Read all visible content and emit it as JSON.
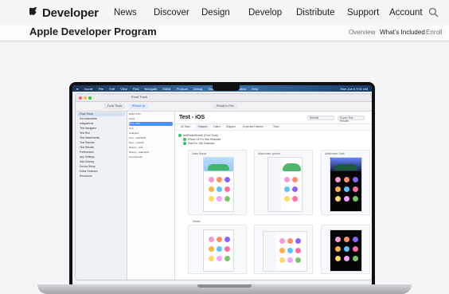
{
  "global_nav": {
    "brand": "Developer",
    "items": [
      "News",
      "Discover",
      "Design",
      "Develop",
      "Distribute",
      "Support",
      "Account"
    ]
  },
  "local_nav": {
    "title": "Apple Developer Program",
    "items": [
      "Overview",
      "What’s Included",
      "Enroll"
    ]
  },
  "mac": {
    "menu_items": [
      "Xcode",
      "File",
      "Edit",
      "View",
      "Find",
      "Navigate",
      "Editor",
      "Product",
      "Debug",
      "Source Control",
      "Window",
      "Help"
    ],
    "clock": "Mon Jun 6 9:41 AM",
    "window_title": "Food Truck",
    "toolbar_tabs": [
      "Food Truck",
      "iPhone 14",
      "Ready to Run"
    ],
    "sidebar_items": [
      "Food Truck",
      "Documentation",
      "Integrations",
      "Test Navigator",
      "Test Run",
      "Test Attachments",
      "Test Reports",
      "Test Results",
      "Preferences",
      "App Settings",
      "Add Sharing",
      "Device Setup",
      "Editor Features",
      "Resources"
    ],
    "navigator_items": [
      "Build: FTD",
      "Tests",
      "Test - iOS",
      "Unit",
      "Analytics",
      "Test - watchOS",
      "Test - macOS",
      "History - iOS",
      "History - watchOS",
      "Test Results"
    ],
    "main_title": "Test - iOS",
    "header_buttons": [
      "Rebuild",
      "Export Test Results"
    ],
    "tabs": [
      "All Tests",
      "Passed",
      "Failed",
      "Skipped",
      "Expected Failures",
      "Tests"
    ],
    "tree_rows": [
      "testRecipeSearch (Food Truck)",
      "iPhone 14 Pro Max Simulator",
      "iPad Pro 13in Simulator"
    ],
    "labels": {
      "top_section": "Sales Report",
      "mid_section": "Details",
      "screenshot_a": "Attachment: portrait",
      "screenshot_b": "Attachment: Dark"
    }
  }
}
